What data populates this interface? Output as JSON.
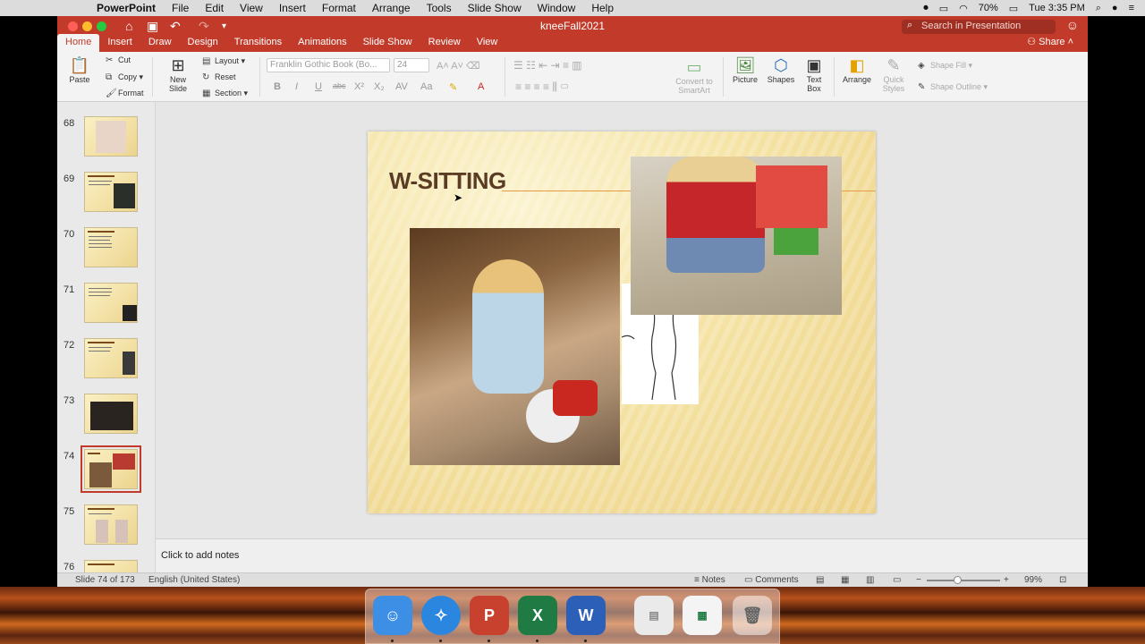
{
  "menubar": {
    "app": "PowerPoint",
    "items": [
      "File",
      "Edit",
      "View",
      "Insert",
      "Format",
      "Arrange",
      "Tools",
      "Slide Show",
      "Window",
      "Help"
    ],
    "battery": "70%",
    "clock": "Tue 3:35 PM"
  },
  "window": {
    "title": "kneeFall2021",
    "search_placeholder": "Search in Presentation",
    "share": "Share"
  },
  "tabs": [
    "Home",
    "Insert",
    "Draw",
    "Design",
    "Transitions",
    "Animations",
    "Slide Show",
    "Review",
    "View"
  ],
  "active_tab": "Home",
  "ribbon": {
    "paste": "Paste",
    "cut": "Cut",
    "copy": "Copy",
    "format": "Format",
    "new_slide": "New Slide",
    "layout": "Layout",
    "reset": "Reset",
    "section": "Section",
    "font_name": "Franklin Gothic Book (Bo...",
    "font_size": "24",
    "convert": "Convert to SmartArt",
    "picture": "Picture",
    "shapes": "Shapes",
    "text_box": "Text Box",
    "arrange": "Arrange",
    "quick_styles": "Quick Styles",
    "shape_fill": "Shape Fill",
    "shape_outline": "Shape Outline"
  },
  "slides_panel": [
    {
      "num": "68"
    },
    {
      "num": "69"
    },
    {
      "num": "70"
    },
    {
      "num": "71"
    },
    {
      "num": "72"
    },
    {
      "num": "73"
    },
    {
      "num": "74"
    },
    {
      "num": "75"
    },
    {
      "num": "76"
    }
  ],
  "selected_slide": "74",
  "slide": {
    "title": "W-SITTING"
  },
  "notes_placeholder": "Click to add notes",
  "status": {
    "slide_info": "Slide 74 of 173",
    "language": "English (United States)",
    "notes": "Notes",
    "comments": "Comments",
    "zoom": "99%"
  },
  "zoom_fraction": 0.42,
  "colors": {
    "ribbon_accent": "#c23b2a",
    "slide_title": "#5a3b24",
    "title_rule": "#e39b45"
  }
}
